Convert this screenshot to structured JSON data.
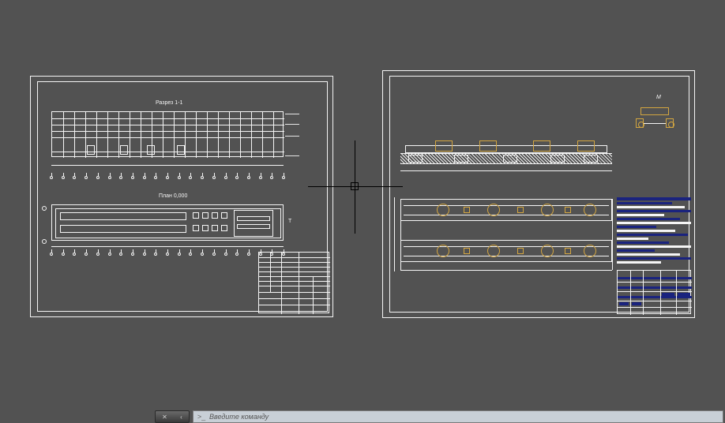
{
  "canvas": {
    "bg": "#525252",
    "line": "#f5f5f5",
    "accent_yellow": "#d4a640",
    "accent_blue": "#1a237e"
  },
  "sheet_left": {
    "section_title": "Разрез 1-1",
    "plan_title": "План 0,000",
    "right_label": "T"
  },
  "sheet_right": {
    "callout": "М"
  },
  "commandline": {
    "prompt_char": ">_",
    "placeholder": "Введите команду"
  }
}
